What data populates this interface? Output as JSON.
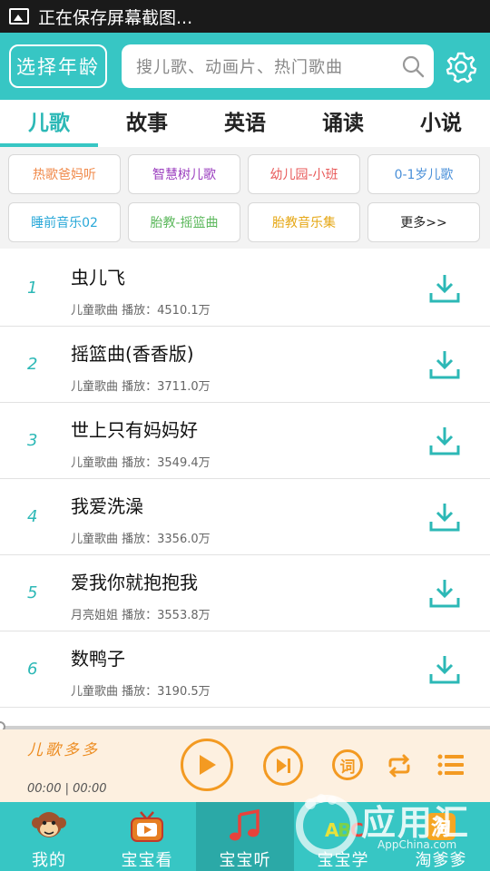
{
  "status_bar": {
    "text": "正在保存屏幕截图..."
  },
  "header": {
    "age_button": "选择年龄",
    "search_placeholder": "搜儿歌、动画片、热门歌曲"
  },
  "tabs": [
    {
      "label": "儿歌",
      "active": true
    },
    {
      "label": "故事"
    },
    {
      "label": "英语"
    },
    {
      "label": "诵读"
    },
    {
      "label": "小说"
    }
  ],
  "chips": [
    {
      "label": "热歌爸妈听",
      "color": "#f08a4b"
    },
    {
      "label": "智慧树儿歌",
      "color": "#9b3fbf"
    },
    {
      "label": "幼儿园-小班",
      "color": "#e85a5a"
    },
    {
      "label": "0-1岁儿歌",
      "color": "#4a90d9"
    },
    {
      "label": "睡前音乐02",
      "color": "#29a8d8"
    },
    {
      "label": "胎教-摇篮曲",
      "color": "#5cb85c"
    },
    {
      "label": "胎教音乐集",
      "color": "#e6a817"
    },
    {
      "label": "更多>>",
      "color": "#222222"
    }
  ],
  "songs": [
    {
      "num": "1",
      "title": "虫儿飞",
      "meta": "儿童歌曲  播放：4510.1万"
    },
    {
      "num": "2",
      "title": "摇篮曲(香香版)",
      "meta": "儿童歌曲  播放：3711.0万"
    },
    {
      "num": "3",
      "title": "世上只有妈妈好",
      "meta": "儿童歌曲  播放：3549.4万"
    },
    {
      "num": "4",
      "title": "我爱洗澡",
      "meta": "儿童歌曲  播放：3356.0万"
    },
    {
      "num": "5",
      "title": "爱我你就抱抱我",
      "meta": "月亮姐姐  播放：3553.8万"
    },
    {
      "num": "6",
      "title": "数鸭子",
      "meta": "儿童歌曲  播放：3190.5万"
    }
  ],
  "player": {
    "name": "儿歌多多",
    "time": "00:00 | 00:00",
    "lyrics_label": "词",
    "progress": 0
  },
  "bottom_nav": [
    {
      "label": "我的",
      "icon": "monkey-icon"
    },
    {
      "label": "宝宝看",
      "icon": "tv-icon"
    },
    {
      "label": "宝宝听",
      "icon": "music-note-icon",
      "active": true
    },
    {
      "label": "宝宝学",
      "icon": "abc-icon"
    },
    {
      "label": "淘爹爹",
      "icon": "shop-icon"
    }
  ],
  "watermark": {
    "brand": "应用汇",
    "url": "AppChina.com"
  },
  "colors": {
    "accent": "#37c6c4",
    "player_accent": "#f39a22"
  }
}
